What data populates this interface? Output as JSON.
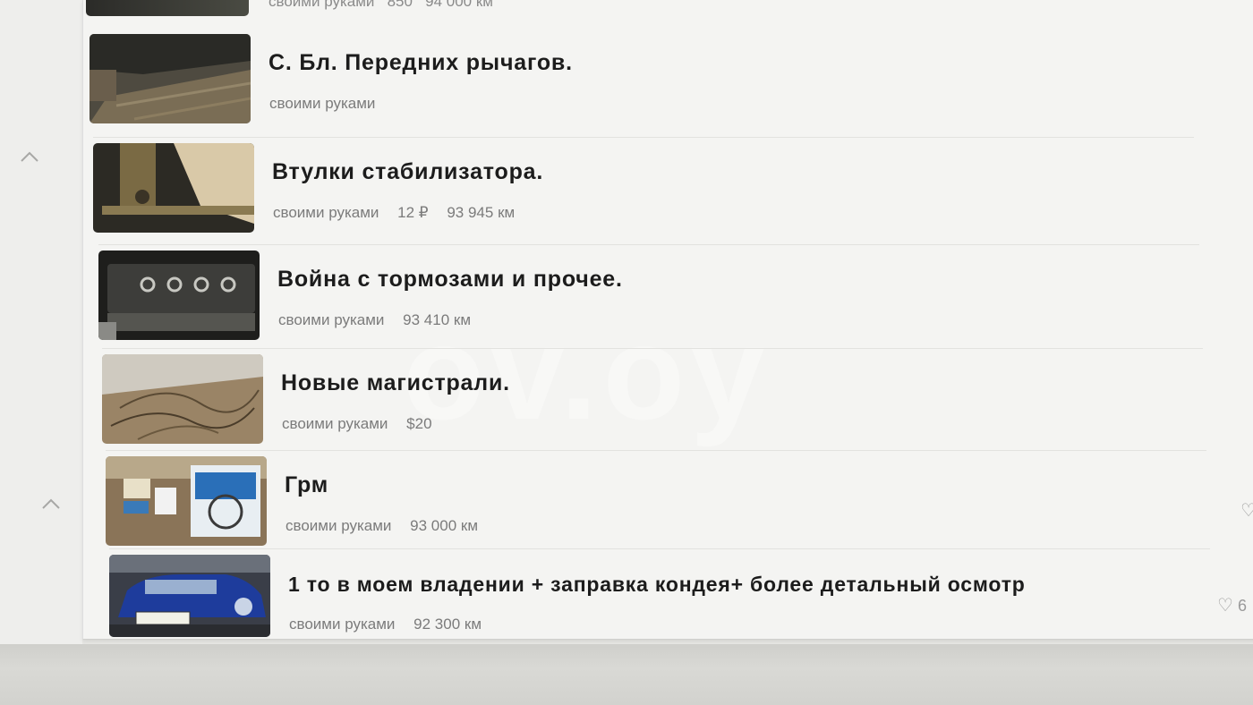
{
  "watermark": "ov.oy",
  "top_row": {
    "meta": [
      "своими руками",
      "850",
      "94 000 км"
    ]
  },
  "entries": [
    {
      "title": "С. Бл. Передних рычагов.",
      "meta": [
        "своими руками"
      ],
      "thumb_icon": "workshop-photo-icon"
    },
    {
      "title": "Втулки стабилизатора.",
      "meta": [
        "своими руками",
        "12 ₽",
        "93 945 км"
      ],
      "thumb_icon": "suspension-photo-icon"
    },
    {
      "title": "Война с тормозами и прочее.",
      "meta": [
        "своими руками",
        "93 410 км"
      ],
      "thumb_icon": "engine-head-photo-icon"
    },
    {
      "title": "Новые магистрали.",
      "meta": [
        "своими руками",
        "$20"
      ],
      "thumb_icon": "brake-lines-photo-icon"
    },
    {
      "title": "Грм",
      "meta": [
        "своими руками",
        "93 000 км"
      ],
      "thumb_icon": "timing-parts-photo-icon"
    },
    {
      "title": "1 то в моем владении + заправка кондея+ более детальный осмотр",
      "meta": [
        "своими руками",
        "92 300 км"
      ],
      "thumb_icon": "blue-car-photo-icon",
      "likes": "6"
    }
  ],
  "icons": {
    "collapse": "chevron-up-icon",
    "like": "heart-icon"
  },
  "colors": {
    "title": "#1c1c1c",
    "meta": "#7b7b7b",
    "background": "#f4f4f2",
    "plate": "#f2f2e8",
    "car_blue": "#1e3c9c"
  }
}
